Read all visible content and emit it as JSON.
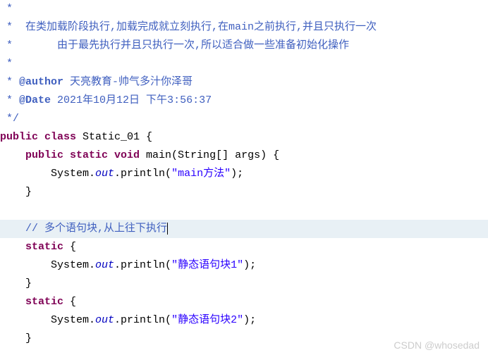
{
  "lines": [
    {
      "indent": " ",
      "tokens": [
        {
          "cls": "comment",
          "txt": "*"
        }
      ]
    },
    {
      "indent": " ",
      "tokens": [
        {
          "cls": "comment",
          "txt": "*  在类加载阶段执行,加载完成就立刻执行,在main之前执行,并且只执行一次"
        }
      ]
    },
    {
      "indent": " ",
      "tokens": [
        {
          "cls": "comment",
          "txt": "*       由于最先执行并且只执行一次,所以适合做一些准备初始化操作"
        }
      ]
    },
    {
      "indent": " ",
      "tokens": [
        {
          "cls": "comment",
          "txt": "*"
        }
      ]
    },
    {
      "indent": " ",
      "tokens": [
        {
          "cls": "comment",
          "txt": "* "
        },
        {
          "cls": "tag",
          "txt": "@author"
        },
        {
          "cls": "comment",
          "txt": " 天亮教育-帅气多汁你泽哥"
        }
      ]
    },
    {
      "indent": " ",
      "tokens": [
        {
          "cls": "comment",
          "txt": "* "
        },
        {
          "cls": "tag",
          "txt": "@Date"
        },
        {
          "cls": "comment",
          "txt": " 2021年10月12日 下午3:56:37"
        }
      ]
    },
    {
      "indent": " ",
      "tokens": [
        {
          "cls": "comment",
          "txt": "*/"
        }
      ]
    },
    {
      "indent": "",
      "tokens": [
        {
          "cls": "keyword",
          "txt": "public class"
        },
        {
          "cls": "type",
          "txt": " Static_01 {"
        }
      ]
    },
    {
      "indent": "    ",
      "tokens": [
        {
          "cls": "keyword",
          "txt": "public static void"
        },
        {
          "cls": "method",
          "txt": " main(String[] args) {"
        }
      ]
    },
    {
      "indent": "        ",
      "tokens": [
        {
          "cls": "method",
          "txt": "System."
        },
        {
          "cls": "static-italic",
          "txt": "out"
        },
        {
          "cls": "method",
          "txt": ".println("
        },
        {
          "cls": "string",
          "txt": "\"main方法\""
        },
        {
          "cls": "method",
          "txt": ");"
        }
      ]
    },
    {
      "indent": "    ",
      "tokens": [
        {
          "cls": "method",
          "txt": "}"
        }
      ]
    },
    {
      "indent": "",
      "tokens": []
    },
    {
      "indent": "    ",
      "highlight": true,
      "cursor": true,
      "tokens": [
        {
          "cls": "comment",
          "txt": "// 多个语句块,从上往下执行"
        }
      ]
    },
    {
      "indent": "    ",
      "tokens": [
        {
          "cls": "keyword",
          "txt": "static"
        },
        {
          "cls": "method",
          "txt": " {"
        }
      ]
    },
    {
      "indent": "        ",
      "tokens": [
        {
          "cls": "method",
          "txt": "System."
        },
        {
          "cls": "static-italic",
          "txt": "out"
        },
        {
          "cls": "method",
          "txt": ".println("
        },
        {
          "cls": "string",
          "txt": "\"静态语句块1\""
        },
        {
          "cls": "method",
          "txt": ");"
        }
      ]
    },
    {
      "indent": "    ",
      "tokens": [
        {
          "cls": "method",
          "txt": "}"
        }
      ]
    },
    {
      "indent": "    ",
      "tokens": [
        {
          "cls": "keyword",
          "txt": "static"
        },
        {
          "cls": "method",
          "txt": " {"
        }
      ]
    },
    {
      "indent": "        ",
      "tokens": [
        {
          "cls": "method",
          "txt": "System."
        },
        {
          "cls": "static-italic",
          "txt": "out"
        },
        {
          "cls": "method",
          "txt": ".println("
        },
        {
          "cls": "string",
          "txt": "\"静态语句块2\""
        },
        {
          "cls": "method",
          "txt": ");"
        }
      ]
    },
    {
      "indent": "    ",
      "tokens": [
        {
          "cls": "method",
          "txt": "}"
        }
      ]
    }
  ],
  "watermark": "CSDN @whosedad"
}
